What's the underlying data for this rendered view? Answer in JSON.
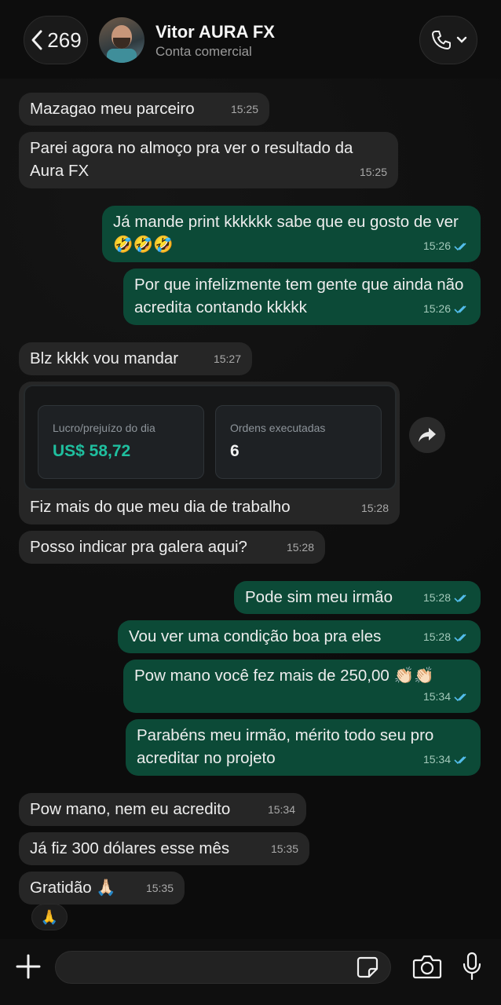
{
  "header": {
    "back_count": "269",
    "contact_name": "Vitor AURA FX",
    "contact_subtitle": "Conta comercial"
  },
  "messages": [
    {
      "text": "Mazagao meu parceiro",
      "time": "15:25",
      "dir": "in"
    },
    {
      "text": "Parei agora no almoço pra ver o resultado da Aura FX",
      "time": "15:25",
      "dir": "in"
    },
    {
      "text": "Já mande print kkkkkk sabe que eu gosto de ver 🤣🤣🤣",
      "time": "15:26",
      "dir": "out"
    },
    {
      "text": "Por que infelizmente tem gente que ainda não acredita contando kkkkk",
      "time": "15:26",
      "dir": "out"
    },
    {
      "text": "Blz kkkk vou mandar",
      "time": "15:27",
      "dir": "in"
    },
    {
      "text": "Fiz mais do que meu dia de trabalho",
      "time": "15:28",
      "dir": "in"
    },
    {
      "text": "Posso indicar pra galera aqui?",
      "time": "15:28",
      "dir": "in"
    },
    {
      "text": "Pode sim meu irmão",
      "time": "15:28",
      "dir": "out"
    },
    {
      "text": "Vou ver uma condição boa pra eles",
      "time": "15:28",
      "dir": "out"
    },
    {
      "text": "Pow mano você fez mais de 250,00 👏🏻👏🏻",
      "time": "15:34",
      "dir": "out"
    },
    {
      "text": "Parabéns meu irmão, mérito todo seu pro acreditar no projeto",
      "time": "15:34",
      "dir": "out"
    },
    {
      "text": "Pow mano, nem eu acredito",
      "time": "15:34",
      "dir": "in"
    },
    {
      "text": "Já fiz 300 dólares esse mês",
      "time": "15:35",
      "dir": "in"
    },
    {
      "text": "Gratidão 🙏🏻",
      "time": "15:35",
      "dir": "in"
    }
  ],
  "screenshot_card": {
    "profit_label": "Lucro/prejuízo do dia",
    "profit_value": "US$ 58,72",
    "orders_label": "Ordens executadas",
    "orders_value": "6",
    "profit_color": "#1fbf9f"
  },
  "reaction": "🙏",
  "colors": {
    "incoming_bubble": "#262626",
    "outgoing_bubble": "#0c4a37",
    "read_ticks": "#53bdeb"
  },
  "icons": [
    "chevron-left-icon",
    "phone-icon",
    "chevron-down-icon",
    "forward-icon",
    "plus-icon",
    "sticker-icon",
    "camera-icon",
    "mic-icon",
    "double-check-icon"
  ]
}
